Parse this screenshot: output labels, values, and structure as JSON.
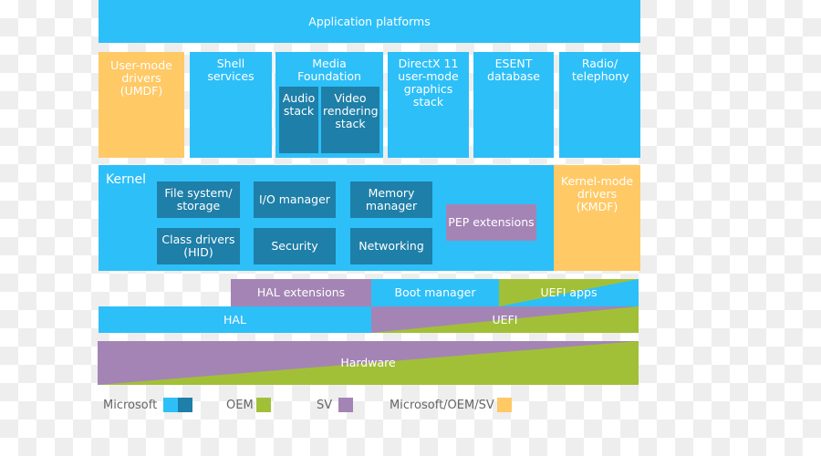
{
  "application_platforms": "Application platforms",
  "user_mode": {
    "umdf": "User-mode drivers (UMDF)",
    "shell": "Shell services",
    "media": "Media Foundation",
    "audio": "Audio stack",
    "video": "Video rendering stack",
    "directx": "DirectX 11 user-mode graphics stack",
    "esent": "ESENT database",
    "radio": "Radio/ telephony"
  },
  "kernel": {
    "title": "Kernel",
    "file_system": "File system/ storage",
    "io": "I/O manager",
    "memory": "Memory manager",
    "pep": "PEP extensions",
    "class_drivers": "Class drivers (HID)",
    "security": "Security",
    "networking": "Networking",
    "kmdf": "Kernel-mode drivers (KMDF)"
  },
  "lower": {
    "hal_ext": "HAL extensions",
    "boot": "Boot manager",
    "uefi_apps": "UEFI apps",
    "hal": "HAL",
    "uefi": "UEFI",
    "hardware": "Hardware"
  },
  "legend": [
    {
      "label": "Microsoft",
      "colors": [
        "#2dbff8",
        "#1e7fa8"
      ]
    },
    {
      "label": "OEM",
      "colors": [
        "#a2c037"
      ]
    },
    {
      "label": "SV",
      "colors": [
        "#a484b5"
      ]
    },
    {
      "label": "Microsoft/OEM/SV",
      "colors": [
        "#ffc966"
      ]
    }
  ]
}
